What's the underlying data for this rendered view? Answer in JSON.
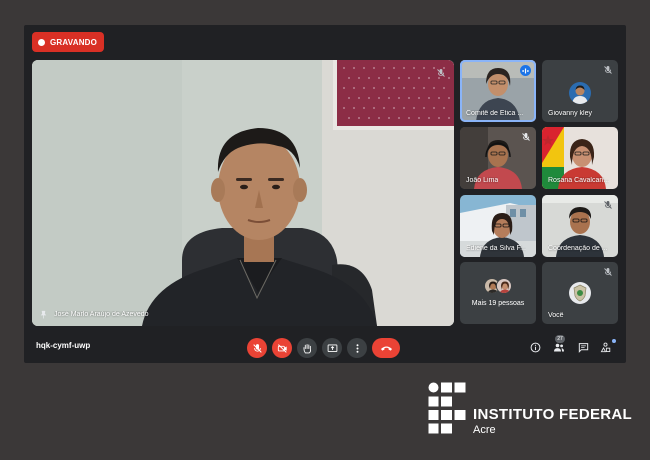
{
  "recording": {
    "label": "GRAVANDO",
    "color": "#d93025"
  },
  "main_tile": {
    "name": "José Marlo Araújo de Azevedo",
    "icon": "pin-icon"
  },
  "participants": [
    {
      "name": "Comitê de Ética ...",
      "active": true,
      "speaking": true
    },
    {
      "name": "Giovanny kley",
      "muted": true,
      "avatar": true
    },
    {
      "name": "João Lima",
      "muted": true
    },
    {
      "name": "Rosana Cavalcan..."
    },
    {
      "name": "Ediene da Silva F..."
    },
    {
      "name": "Coordenação de ...",
      "muted": true
    },
    {
      "name": "Você",
      "muted": true
    }
  ],
  "more_people": {
    "label": "Mais 19 pessoas"
  },
  "meeting_code": "hqk-cymf-uwp",
  "controls": [
    {
      "name": "mic-toggle",
      "icon": "mic-off-icon",
      "state": "off"
    },
    {
      "name": "camera-toggle",
      "icon": "camera-off-icon",
      "state": "off"
    },
    {
      "name": "raise-hand",
      "icon": "hand-icon"
    },
    {
      "name": "present-screen",
      "icon": "present-icon"
    },
    {
      "name": "more-options",
      "icon": "more-vert-icon"
    },
    {
      "name": "leave-call",
      "icon": "phone-hangup-icon"
    }
  ],
  "right_tools": {
    "participant_count": "27",
    "icons": [
      "info-icon",
      "people-icon",
      "chat-icon",
      "activities-icon"
    ]
  },
  "logo": {
    "name": "INSTITUTO FEDERAL",
    "subtitle": "Acre"
  },
  "colors": {
    "accent": "#8ab4f8",
    "danger": "#ea4335",
    "surface": "#202124",
    "tile": "#3c4043"
  }
}
